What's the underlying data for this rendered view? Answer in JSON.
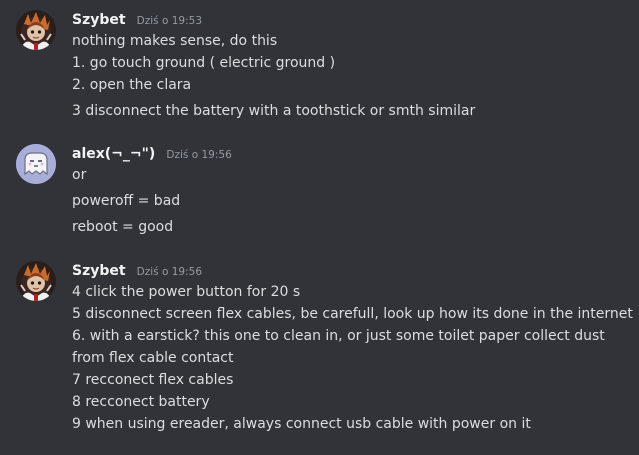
{
  "messages": [
    {
      "author": "Szybet",
      "timestamp": "Dziś o 19:53",
      "lines": [
        "nothing makes sense, do this",
        "1. go touch ground ( electric ground )",
        "2. open the clara",
        "3 disconnect the battery with a toothstick or smth similar"
      ]
    },
    {
      "author": "alex(¬_¬\")",
      "timestamp": "Dziś o 19:56",
      "lines": [
        "or",
        "poweroff = bad",
        "reboot = good"
      ]
    },
    {
      "author": "Szybet",
      "timestamp": "Dziś o 19:56",
      "lines": [
        "4 click the power button for 20 s",
        "5 disconnect screen flex cables, be carefull, look up how its done in the internet",
        "6. with a earstick? this one to clean in, or just some toilet paper collect dust",
        "from flex cable contact",
        "7 recconect flex cables",
        "8 recconect battery",
        "9 when using ereader, always connect usb cable with power on it"
      ]
    }
  ],
  "colors": {
    "background": "#313338",
    "text": "#dbdee1",
    "author": "#f2f3f5",
    "timestamp": "#949ba4",
    "alex_avatar_bg": "#a8aed8"
  },
  "icons": {
    "szybet_avatar": "character-portrait-icon",
    "alex_avatar": "ghost-blob-icon"
  }
}
